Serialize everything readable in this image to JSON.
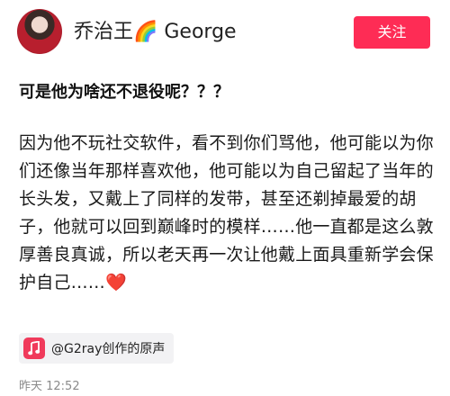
{
  "author": {
    "name": "乔治王🌈 George",
    "follow_label": "关注"
  },
  "post": {
    "title": "可是他为啥还不退役呢？？？",
    "body": "因为他不玩社交软件，看不到你们骂他，他可能以为你们还像当年那样喜欢他，他可能以为自己留起了当年的长头发，又戴上了同样的发带，甚至还剃掉最爱的胡子，他就可以回到巅峰时的模样……他一直都是这么敦厚善良真诚，所以老天再一次让他戴上面具重新学会保护自己……",
    "end_emoji": "❤️"
  },
  "music": {
    "label": "@G2ray创作的原声",
    "icon": "music-note-icon"
  },
  "timestamp": "昨天 12:52",
  "colors": {
    "follow_button": "#fe2c55",
    "music_icon_bg": "#f03a5b",
    "chip_bg": "#f2f2f4",
    "timestamp": "#8a8a8a"
  }
}
